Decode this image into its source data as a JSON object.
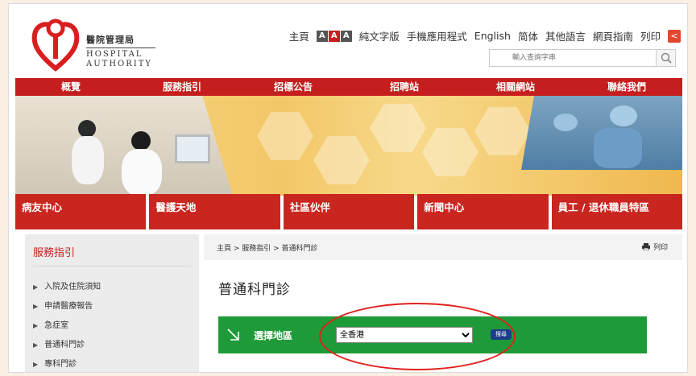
{
  "header": {
    "logo_cn": "醫院管理局",
    "logo_en_line1": "HOSPITAL",
    "logo_en_line2": "AUTHORITY",
    "top_links": [
      "主頁",
      "純文字版",
      "手機應用程式",
      "English",
      "简体",
      "其他語言",
      "網頁指南",
      "列印"
    ],
    "font_size_buttons": [
      "A",
      "A",
      "A"
    ],
    "search_placeholder": "輸入查詢字串"
  },
  "main_nav": [
    "概覽",
    "服務指引",
    "招標公告",
    "招聘站",
    "相關網站",
    "聯絡我們"
  ],
  "sub_nav": [
    "病友中心",
    "醫護天地",
    "社區伙伴",
    "新聞中心",
    "員工 / 退休職員特區"
  ],
  "sidebar": {
    "title": "服務指引",
    "items": [
      "入院及住院須知",
      "申請醫療報告",
      "急症室",
      "普通科門診",
      "專科門診"
    ]
  },
  "content": {
    "breadcrumb": "主頁 > 服務指引 > 普通科門診",
    "print_label": "列印",
    "page_title": "普通科門診",
    "region_label": "選擇地區",
    "region_selected": "全香港",
    "search_button": "搜尋"
  },
  "colors": {
    "brand_red": "#c41e1e",
    "green_bar": "#1f9a38",
    "annotation_circle": "#e0211e"
  }
}
